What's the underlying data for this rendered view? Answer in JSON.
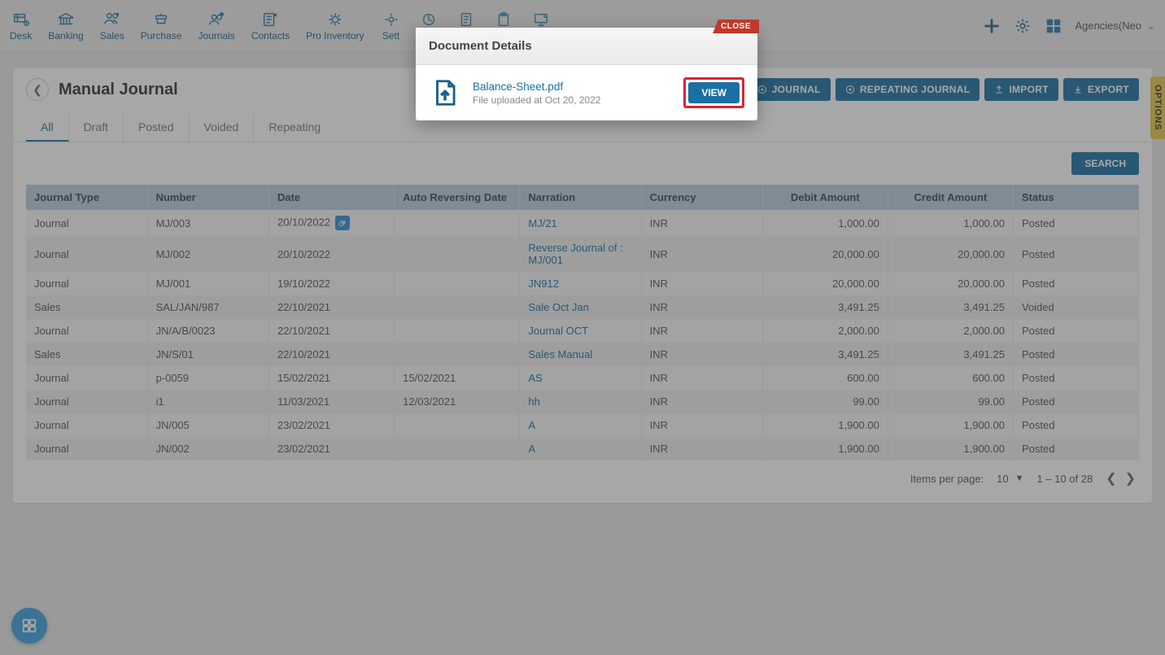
{
  "nav": {
    "items": [
      {
        "label": "Desk"
      },
      {
        "label": "Banking"
      },
      {
        "label": "Sales"
      },
      {
        "label": "Purchase"
      },
      {
        "label": "Journals"
      },
      {
        "label": "Contacts"
      },
      {
        "label": "Pro Inventory"
      },
      {
        "label": "Sett"
      }
    ],
    "company": "Agencies(Neo"
  },
  "page": {
    "title": "Manual Journal",
    "actions": {
      "journal": "JOURNAL",
      "repeating": "REPEATING JOURNAL",
      "import": "IMPORT",
      "export": "EXPORT"
    },
    "tabs": [
      "All",
      "Draft",
      "Posted",
      "Voided",
      "Repeating"
    ],
    "search": "SEARCH",
    "options_tab": "OPTIONS"
  },
  "table": {
    "headers": [
      "Journal Type",
      "Number",
      "Date",
      "Auto Reversing Date",
      "Narration",
      "Currency",
      "Debit Amount",
      "Credit Amount",
      "Status"
    ],
    "rows": [
      {
        "type": "Journal",
        "num": "MJ/003",
        "date": "20/10/2022",
        "rev": "",
        "narr": "MJ/21",
        "cur": "INR",
        "debit": "1,000.00",
        "credit": "1,000.00",
        "status": "Posted",
        "chip": true
      },
      {
        "type": "Journal",
        "num": "MJ/002",
        "date": "20/10/2022",
        "rev": "",
        "narr": "Reverse Journal of : MJ/001",
        "cur": "INR",
        "debit": "20,000.00",
        "credit": "20,000.00",
        "status": "Posted"
      },
      {
        "type": "Journal",
        "num": "MJ/001",
        "date": "19/10/2022",
        "rev": "",
        "narr": "JN912",
        "cur": "INR",
        "debit": "20,000.00",
        "credit": "20,000.00",
        "status": "Posted"
      },
      {
        "type": "Sales",
        "num": "SAL/JAN/987",
        "date": "22/10/2021",
        "rev": "",
        "narr": "Sale Oct Jan",
        "cur": "INR",
        "debit": "3,491.25",
        "credit": "3,491.25",
        "status": "Voided"
      },
      {
        "type": "Journal",
        "num": "JN/A/B/0023",
        "date": "22/10/2021",
        "rev": "",
        "narr": "Journal OCT",
        "cur": "INR",
        "debit": "2,000.00",
        "credit": "2,000.00",
        "status": "Posted"
      },
      {
        "type": "Sales",
        "num": "JN/S/01",
        "date": "22/10/2021",
        "rev": "",
        "narr": "Sales Manual",
        "cur": "INR",
        "debit": "3,491.25",
        "credit": "3,491.25",
        "status": "Posted"
      },
      {
        "type": "Journal",
        "num": "p-0059",
        "date": "15/02/2021",
        "rev": "15/02/2021",
        "narr": "AS",
        "cur": "INR",
        "debit": "600.00",
        "credit": "600.00",
        "status": "Posted"
      },
      {
        "type": "Journal",
        "num": "i1",
        "date": "11/03/2021",
        "rev": "12/03/2021",
        "narr": "hh",
        "cur": "INR",
        "debit": "99.00",
        "credit": "99.00",
        "status": "Posted"
      },
      {
        "type": "Journal",
        "num": "JN/005",
        "date": "23/02/2021",
        "rev": "",
        "narr": "A",
        "cur": "INR",
        "debit": "1,900.00",
        "credit": "1,900.00",
        "status": "Posted"
      },
      {
        "type": "Journal",
        "num": "JN/002",
        "date": "23/02/2021",
        "rev": "",
        "narr": "A",
        "cur": "INR",
        "debit": "1,900.00",
        "credit": "1,900.00",
        "status": "Posted"
      }
    ]
  },
  "pager": {
    "label": "Items per page:",
    "size": "10",
    "range": "1 – 10 of 28"
  },
  "modal": {
    "close": "CLOSE",
    "title": "Document Details",
    "file_name": "Balance-Sheet.pdf",
    "file_meta": "File uploaded at Oct 20, 2022",
    "view": "VIEW"
  }
}
